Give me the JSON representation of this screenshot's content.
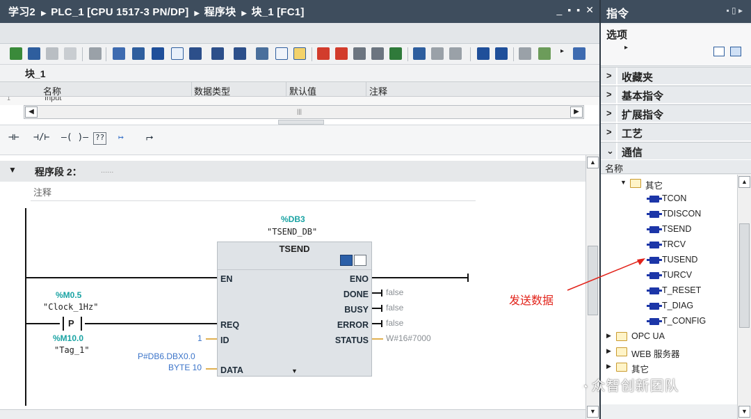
{
  "breadcrumb": {
    "project": "学习2",
    "device": "PLC_1 [CPU 1517-3 PN/DP]",
    "folder": "程序块",
    "block": "块_1 [FC1]"
  },
  "window_buttons": [
    "_",
    "▪",
    "▪",
    "✕"
  ],
  "block_title": "块_1",
  "interface": {
    "columns": [
      "名称",
      "数据类型",
      "默认值",
      "注释"
    ],
    "row_index": "1",
    "row_label": "Input"
  },
  "network": {
    "title": "程序段 2：",
    "dots": "......",
    "comment": "注释"
  },
  "ladder_toolbar": [
    "⊣⊢",
    "⊣/⊢",
    "–( )–",
    "??",
    "↦",
    "⮣"
  ],
  "fb": {
    "instance_addr": "%DB3",
    "instance_name": "\"TSEND_DB\"",
    "name": "TSEND",
    "pins_in": [
      "EN",
      "REQ",
      "ID",
      "DATA"
    ],
    "pins_out": [
      "ENO",
      "DONE",
      "BUSY",
      "ERROR",
      "STATUS"
    ],
    "out_values": {
      "done": "false",
      "busy": "false",
      "error": "false",
      "status": "W#16#7000"
    },
    "id_value": "1",
    "data_addr": "P#DB6.DBX0.0",
    "data_len": "BYTE 10"
  },
  "contact": {
    "addr": "%M0.5",
    "name": "\"Clock_1Hz\"",
    "type": "P",
    "edge_addr": "%M10.0",
    "edge_name": "\"Tag_1\""
  },
  "right_pane": {
    "title": "指令",
    "options": "选项",
    "sections": [
      "收藏夹",
      "基本指令",
      "扩展指令",
      "工艺",
      "通信"
    ],
    "tree_header": "名称",
    "tree": [
      {
        "type": "folder",
        "label": "其它",
        "level": 1,
        "expanded": true
      },
      {
        "type": "fb",
        "label": "TCON"
      },
      {
        "type": "fb",
        "label": "TDISCON"
      },
      {
        "type": "fb",
        "label": "TSEND"
      },
      {
        "type": "fb",
        "label": "TRCV"
      },
      {
        "type": "fb",
        "label": "TUSEND"
      },
      {
        "type": "fb",
        "label": "TURCV"
      },
      {
        "type": "fb",
        "label": "T_RESET"
      },
      {
        "type": "fb",
        "label": "T_DIAG"
      },
      {
        "type": "fb",
        "label": "T_CONFIG"
      },
      {
        "type": "folder",
        "label": "OPC UA",
        "level": 0
      },
      {
        "type": "folder",
        "label": "WEB 服务器",
        "level": 0
      },
      {
        "type": "folder",
        "label": "其它",
        "level": 0
      }
    ]
  },
  "annotation": "发送数据",
  "watermark": "众智创新团队",
  "colors": {
    "titlebar": "#3e4d5d",
    "accent_teal": "#19a3a3",
    "annotation_red": "#e2231a",
    "fb_icon": "#1c36a8"
  }
}
